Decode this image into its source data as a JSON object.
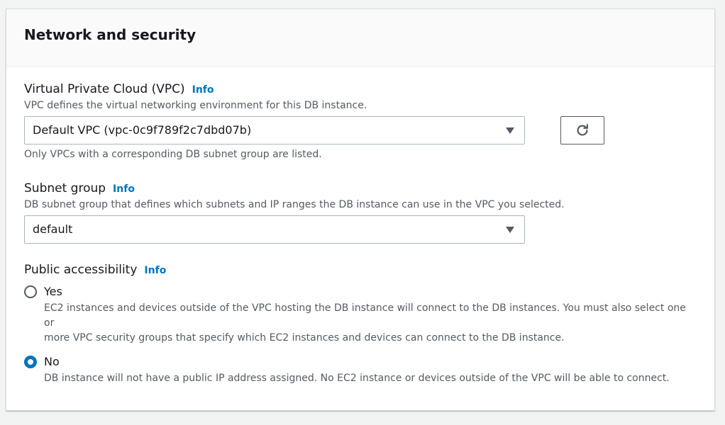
{
  "section": {
    "title": "Network and security"
  },
  "vpc": {
    "label": "Virtual Private Cloud (VPC)",
    "info": "Info",
    "description": "VPC defines the virtual networking environment for this DB instance.",
    "selected": "Default VPC (vpc-0c9f789f2c7dbd07b)",
    "hint": "Only VPCs with a corresponding DB subnet group are listed."
  },
  "subnet": {
    "label": "Subnet group",
    "info": "Info",
    "description": "DB subnet group that defines which subnets and IP ranges the DB instance can use in the VPC you selected.",
    "selected": "default"
  },
  "public": {
    "label": "Public accessibility",
    "info": "Info",
    "options": [
      {
        "label": "Yes",
        "checked": false,
        "description_line1": "EC2 instances and devices outside of the VPC hosting the DB instance will connect to the DB instances. You must also select one or",
        "description_line2": "more VPC security groups that specify which EC2 instances and devices can connect to the DB instance."
      },
      {
        "label": "No",
        "checked": true,
        "description_line1": "DB instance will not have a public IP address assigned. No EC2 instance or devices outside of the VPC will be able to connect."
      }
    ]
  },
  "colors": {
    "accent": "#0073bb",
    "text": "#16191f",
    "secondary_text": "#545b64",
    "background": "#f2f3f3"
  },
  "icons": {
    "refresh": "refresh-icon",
    "caret": "caret-down-icon"
  }
}
